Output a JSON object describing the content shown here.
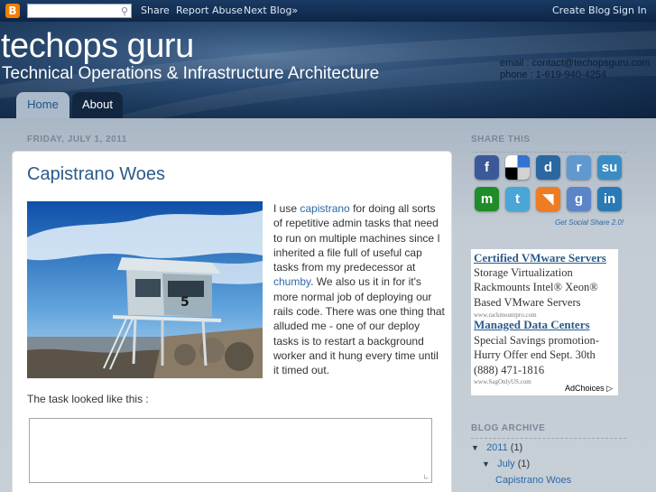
{
  "navbar": {
    "share": "Share",
    "report_abuse": "Report Abuse",
    "next_blog": "Next Blog»",
    "create_blog": "Create Blog",
    "sign_in": "Sign In"
  },
  "header": {
    "title": "techops guru",
    "subtitle": "Technical Operations & Infrastructure Architecture",
    "email": "email : contact@techopsguru.com",
    "phone": "phone : 1-619-940-4254"
  },
  "tabs": [
    {
      "label": "Home"
    },
    {
      "label": "About"
    }
  ],
  "post": {
    "date": "FRIDAY, JULY 1, 2011",
    "title": "Capistrano Woes",
    "text_1": "I use ",
    "link_1": "capistrano",
    "text_2": " for doing all sorts of repetitive admin tasks that need to run on multiple machines since I inherited a file full of useful cap tasks from my predecessor at ",
    "link_2": "chumby",
    "text_3": ". We also us it in for it's more normal job of deploying our rails code. There was one thing that alluded me - one of our deploy tasks is to restart a background worker and it hung every time until it timed out.",
    "para2": "The task looked like this :",
    "image_label": "5"
  },
  "sidebar": {
    "share_heading": "SHARE THIS",
    "share_credit": "Get Social Share 2.0!",
    "share_icons": [
      {
        "name": "facebook",
        "glyph": "f",
        "color": "#3b5998"
      },
      {
        "name": "delicious",
        "glyph": "",
        "color": "#2a2a2a"
      },
      {
        "name": "digg",
        "glyph": "d",
        "color": "#2b68a1"
      },
      {
        "name": "reddit",
        "glyph": "r",
        "color": "#5f99cf"
      },
      {
        "name": "stumbleupon",
        "glyph": "su",
        "color": "#3a8dc4"
      },
      {
        "name": "myspace",
        "glyph": "m",
        "color": "#1f8c2a"
      },
      {
        "name": "twitter",
        "glyph": "t",
        "color": "#4aa6d6"
      },
      {
        "name": "rss",
        "glyph": "◥",
        "color": "#ef7b23"
      },
      {
        "name": "google",
        "glyph": "g",
        "color": "#5c84c8"
      },
      {
        "name": "linkedin",
        "glyph": "in",
        "color": "#2a7ab5"
      }
    ],
    "ad": {
      "title_1": "Certified VMware Servers",
      "body_1": "Storage Virtualization Rackmounts Intel® Xeon® Based VMware Servers",
      "url_1": "www.rackmountpro.com",
      "title_2": "Managed Data Centers",
      "body_2": "Special Savings promotion-Hurry Offer end Sept. 30th (888) 471-1816",
      "url_2": "www.SagOnlyUS.com",
      "adchoices": "AdChoices ▷"
    },
    "archive_heading": "BLOG ARCHIVE",
    "archive": {
      "year": "2011",
      "year_count": "(1)",
      "month": "July",
      "month_count": "(1)",
      "post": "Capistrano Woes"
    }
  }
}
